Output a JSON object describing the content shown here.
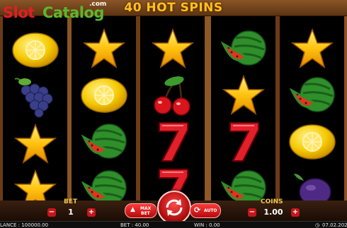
{
  "header": {
    "title": "40 HOT SPINS"
  },
  "logo": {
    "part1": "Slot",
    "part2": "Catalog",
    "suffix": ".com"
  },
  "reels": [
    [
      "lemon",
      "grapes",
      "star",
      "star"
    ],
    [
      "star",
      "lemon",
      "watermelon",
      "watermelon"
    ],
    [
      "star",
      "cherries",
      "seven",
      "seven"
    ],
    [
      "watermelon",
      "star",
      "seven",
      "watermelon"
    ],
    [
      "star",
      "watermelon",
      "lemon",
      "plum"
    ]
  ],
  "controls": {
    "bet_label": "BET",
    "bet_value": "1",
    "minus": "−",
    "plus": "+",
    "maxbet_line1": "MAX",
    "maxbet_line2": "BET",
    "auto_label": "AUTO",
    "coins_label": "COINS",
    "coins_value": "1.00"
  },
  "status": {
    "balance": "LANCE : 100000.00",
    "bet": "BET : 40.00",
    "win": "WIN : 0.00",
    "date": "07.02.202"
  },
  "colors": {
    "title": "#ffc21a",
    "frame": "#7a4820",
    "button": "#c4161c",
    "label": "#f2c94c"
  }
}
